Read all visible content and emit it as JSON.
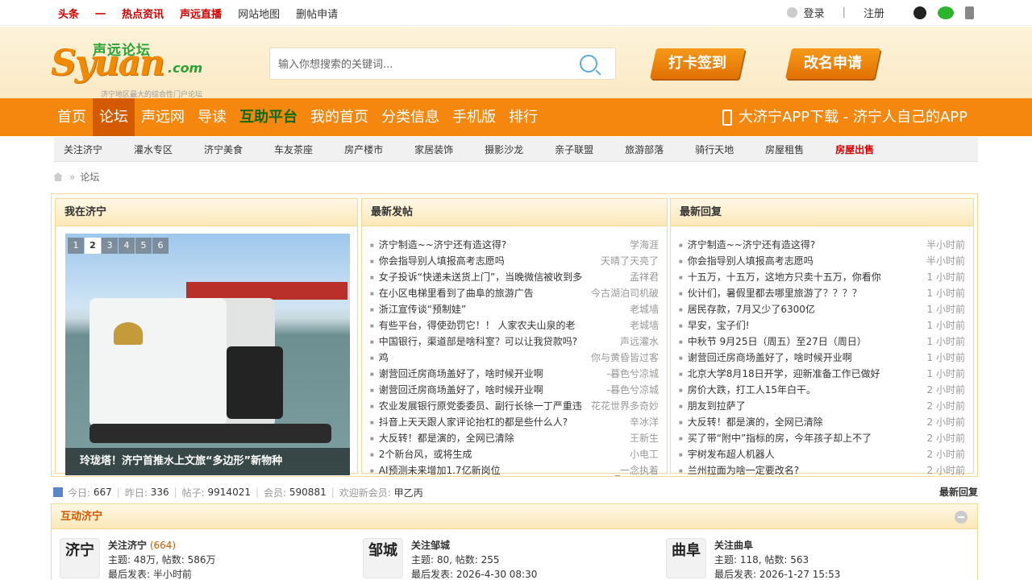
{
  "topbar": {
    "links": [
      "头条",
      "一",
      "热点资讯",
      "声远直播",
      "网站地图",
      "删帖申请"
    ],
    "login": "登录",
    "register": "注册"
  },
  "header": {
    "logo_main": "Syuan",
    "logo_com": ".com",
    "logo_cn": "声远论坛",
    "logo_sub": "济宁地区最大的综合性门户论坛",
    "search_placeholder": "输入你想搜索的关键词...",
    "btn_checkin": "打卡签到",
    "btn_rename": "改名申请"
  },
  "nav": {
    "items": [
      "首页",
      "论坛",
      "声远网",
      "导读",
      "互助平台",
      "我的首页",
      "分类信息",
      "手机版",
      "排行"
    ],
    "app": "大济宁APP下载 - 济宁人自己的APP"
  },
  "subnav": [
    "关注济宁",
    "灌水专区",
    "济宁美食",
    "车友茶座",
    "房产楼市",
    "家居装饰",
    "摄影沙龙",
    "亲子联盟",
    "旅游部落",
    "骑行天地",
    "房屋租售",
    "房屋出售"
  ],
  "breadcrumb": {
    "sep": "»",
    "current": "论坛"
  },
  "panel1": {
    "title": "我在济宁",
    "pages": [
      "1",
      "2",
      "3",
      "4",
      "5",
      "6"
    ],
    "caption": "玲珑塔！济宁首推水上文旅“多边形”新物种"
  },
  "panel2": {
    "title": "最新发帖",
    "rows": [
      {
        "t": "济宁制造~~济宁还有造这得?",
        "a": "学海涯"
      },
      {
        "t": "你会指导别人填报高考志愿吗",
        "a": "天晴了天亮了"
      },
      {
        "t": "女子投诉“快递未送货上门”，当晚微信被收到多",
        "a": "孟祥君"
      },
      {
        "t": "在小区电梯里看到了曲阜的旅游广告",
        "a": "今古湖泊司机破"
      },
      {
        "t": "浙江宣传谈“预制娃”",
        "a": "老城墙"
      },
      {
        "t": "有些平台，得使劲罚它！！ 人家农夫山泉的老",
        "a": "老城墙"
      },
      {
        "t": "中国银行，渠道部是啥科室？可以让我贷款吗?",
        "a": "声远灌水"
      },
      {
        "t": "鸡",
        "a": "你与黄昏皆过客"
      },
      {
        "t": "谢营回迁房商场盖好了，啥时候开业啊",
        "a": "-暮色兮凉城"
      },
      {
        "t": "谢营回迁房商场盖好了，啥时候开业啊",
        "a": "-暮色兮凉城"
      },
      {
        "t": "农业发展银行原党委委员、副行长徐一丁严重违",
        "a": "花花世界多奇妙"
      },
      {
        "t": "抖音上天天跟人家评论抬杠的都是些什么人?",
        "a": "辛冰洋"
      },
      {
        "t": "大反转！都是演的，全网已清除",
        "a": "王新生"
      },
      {
        "t": "2个新台风，或将生成",
        "a": "小电工"
      },
      {
        "t": "AI预测未来增加1.7亿新岗位",
        "a": "_一念执着"
      }
    ]
  },
  "panel3": {
    "title": "最新回复",
    "rows": [
      {
        "t": "济宁制造~~济宁还有造这得?",
        "a": "半小时前"
      },
      {
        "t": "你会指导别人填报高考志愿吗",
        "a": "半小时前"
      },
      {
        "t": "十五万，十五万，这地方只卖十五万，你看你",
        "a": "1 小时前"
      },
      {
        "t": "伙计们，暑假里都去哪里旅游了？？？？",
        "a": "1 小时前"
      },
      {
        "t": "居民存款，7月又少了6300亿",
        "a": "1 小时前"
      },
      {
        "t": "早安，宝子们!",
        "a": "1 小时前"
      },
      {
        "t": "中秋节 9月25日（周五）至27日（周日）",
        "a": "1 小时前"
      },
      {
        "t": "谢营回迁房商场盖好了，啥时候开业啊",
        "a": "1 小时前"
      },
      {
        "t": "北京大学8月18日开学，迎新准备工作已做好",
        "a": "1 小时前"
      },
      {
        "t": "房价大跌，打工人15年白干。",
        "a": "2 小时前"
      },
      {
        "t": "朋友到拉萨了",
        "a": "2 小时前"
      },
      {
        "t": "大反转！都是演的，全网已清除",
        "a": "2 小时前"
      },
      {
        "t": "买了带“附中”指标的房，今年孩子却上不了",
        "a": "2 小时前"
      },
      {
        "t": "宇树发布超人机器人",
        "a": "2 小时前"
      },
      {
        "t": "兰州拉面为啥一定要改名?",
        "a": "2 小时前"
      }
    ]
  },
  "stats": {
    "today_label": "今日:",
    "today": "667",
    "yesterday_label": "昨日:",
    "yesterday": "336",
    "posts_label": "帖子:",
    "posts": "9914021",
    "members_label": "会员:",
    "members": "590881",
    "welcome_label": "欢迎新会员:",
    "welcome": "甲乙丙",
    "latest_reply": "最新回复"
  },
  "section": {
    "title": "互动济宁",
    "forums": [
      {
        "pic": "济宁",
        "name": "关注济宁",
        "count": "(664)",
        "stats": "主题: 48万, 帖数: 586万",
        "last": "最后发表: 半小时前"
      },
      {
        "pic": "邹城",
        "name": "关注邹城",
        "count": "",
        "stats": "主题: 80, 帖数: 255",
        "last": "最后发表: 2026-4-30 08:30"
      },
      {
        "pic": "曲阜",
        "name": "关注曲阜",
        "count": "",
        "stats": "主题: 118, 帖数: 563",
        "last": "最后发表: 2026-1-27 15:53"
      }
    ]
  }
}
